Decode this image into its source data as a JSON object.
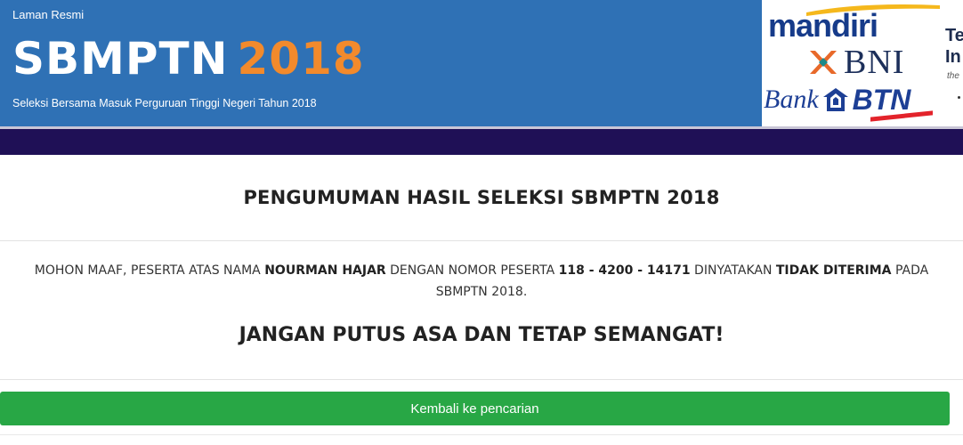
{
  "header": {
    "kicker": "Laman Resmi",
    "brand_main": "SBMPTN",
    "brand_year": "2018",
    "subtitle": "Seleksi Bersama Masuk Perguruan Tinggi Negeri Tahun 2018",
    "colors": {
      "header_bg": "#2f71b5",
      "year_accent": "#f28a2c",
      "navbar": "#1f1056"
    }
  },
  "sponsors": {
    "mandiri": "mandiri",
    "bni": "BNI",
    "btn_bank": "Bank",
    "btn": "BTN",
    "telkom_line1": "Te",
    "telkom_line2": "In",
    "telkom_sub": "the"
  },
  "announcement": {
    "title": "PENGUMUMAN HASIL SELEKSI SBMPTN 2018",
    "msg_part1": "MOHON MAAF, PESERTA ATAS NAMA ",
    "name": "NOURMAN HAJAR",
    "msg_part2": " DENGAN NOMOR PESERTA ",
    "number": "118 - 4200 - 14171",
    "msg_part3": " DINYATAKAN ",
    "status": "TIDAK DITERIMA",
    "msg_part4": " PADA SBMPTN 2018.",
    "slogan": "JANGAN PUTUS ASA DAN TETAP SEMANGAT!"
  },
  "actions": {
    "back_label": "Kembali ke pencarian",
    "back_color": "#28a745"
  }
}
